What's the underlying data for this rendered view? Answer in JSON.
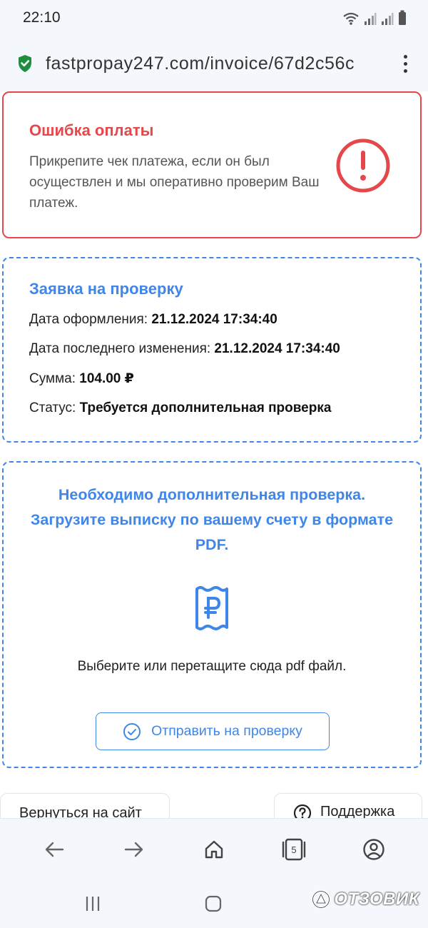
{
  "status_bar": {
    "time": "22:10"
  },
  "browser": {
    "url": "fastpropay247.com/invoice/67d2c56c",
    "tab_count": "5"
  },
  "error_card": {
    "title": "Ошибка оплаты",
    "text": "Прикрепите чек платежа, если он был осуществлен и мы оперативно проверим Ваш платеж.",
    "accent_color": "#e4484a"
  },
  "request_card": {
    "title": "Заявка на проверку",
    "rows": [
      {
        "label": "Дата оформления:",
        "value": "21.12.2024 17:34:40"
      },
      {
        "label": "Дата последнего изменения:",
        "value": "21.12.2024 17:34:40"
      },
      {
        "label": "Сумма:",
        "value": "104.00 ₽"
      },
      {
        "label": "Статус:",
        "value": "Требуется дополнительная проверка"
      }
    ],
    "accent_color": "#3f86e8"
  },
  "upload_card": {
    "heading": "Необходимо дополнительная проверка. Загрузите выписку по вашему счету в формате PDF.",
    "hint": "Выберите или перетащите сюда pdf файл.",
    "submit_label": "Отправить на проверку"
  },
  "footer_buttons": {
    "back_label": "Вернуться на сайт",
    "support_label": "Поддержка"
  },
  "watermark": "ОТЗОВИК",
  "icons": {
    "secure": "shield-check-icon",
    "error": "exclamation-circle-icon",
    "receipt": "ruble-receipt-icon",
    "submit": "check-circle-icon",
    "support": "question-circle-icon"
  }
}
